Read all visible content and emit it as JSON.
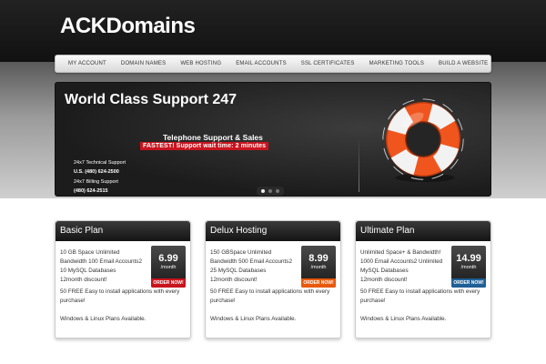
{
  "brand": {
    "logo": "ACKDomains"
  },
  "nav": {
    "items": [
      "MY ACCOUNT",
      "DOMAIN NAMES",
      "WEB HOSTING",
      "EMAIL ACCOUNTS",
      "SSL CERTIFICATES",
      "MARKETING TOOLS",
      "BUILD A WEBSITE"
    ]
  },
  "slider": {
    "title": "World Class Support 247",
    "support_title": "Telephone Support & Sales",
    "fastest": "FASTEST! Support wait time: 2 minutes",
    "contact": [
      "24x7 Technical Support",
      "U.S. (480) 624-2500",
      "24x7 Billing Support",
      "(480) 624-2515"
    ],
    "dots": {
      "count": 3,
      "active_index": 0
    }
  },
  "plans": [
    {
      "name": "Basic Plan",
      "features": [
        "10 GB Space Unlimited",
        "Bandwidth 100 Email Accounts2",
        "10 MySQL Databases",
        "12month discount!"
      ],
      "price": "6.99",
      "per": "/month",
      "order": "ORDER NOW!",
      "order_color": "#c8141e",
      "desc": "50 FREE Easy to install applications with every purchase!",
      "platforms": "Windows & Linux Plans Available."
    },
    {
      "name": "Delux Hosting",
      "features": [
        "150 GBSpace Unlimited",
        "Bandwidth 500 Email Accounts2",
        "25 MySQL Databases",
        "12month discount!"
      ],
      "price": "8.99",
      "per": "/month",
      "order": "ORDER NOW!",
      "order_color": "#e8590c",
      "desc": "50 FREE Easy to install applications with every purchase!",
      "platforms": "Windows & Linux Plans Available."
    },
    {
      "name": "Ultimate Plan",
      "features": [
        "Unlimited Space+ & Bandwidth!",
        "1000 Email Accounts2 Unlimited",
        "MySQL Databases",
        "12month discount!"
      ],
      "price": "14.99",
      "per": "/month",
      "order": "ORDER NOW!",
      "order_color": "#1f5f96",
      "desc": "50 FREE Easy to install applications with every purchase!",
      "platforms": "Windows & Linux Plans Available."
    }
  ],
  "colors": {
    "header_bg": "#111111",
    "accent_red": "#c8141e",
    "buoy_orange": "#f0551e"
  }
}
